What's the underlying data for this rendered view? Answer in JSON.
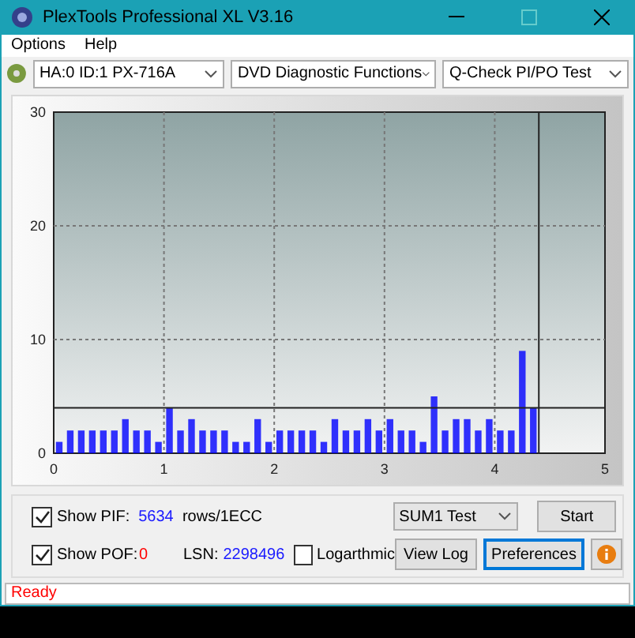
{
  "window": {
    "title": "PlexTools Professional XL V3.16"
  },
  "menu": [
    {
      "label": "Options"
    },
    {
      "label": "Help"
    }
  ],
  "toolbar": {
    "drive": "HA:0 ID:1  PX-716A",
    "function": "DVD Diagnostic Functions",
    "test": "Q-Check PI/PO Test"
  },
  "chart": {
    "chart_data": {
      "type": "bar",
      "xlim": [
        0,
        5
      ],
      "ylim": [
        0,
        30
      ],
      "xticks": [
        0,
        1,
        2,
        3,
        4,
        5
      ],
      "yticks": [
        0,
        10,
        20,
        30
      ],
      "x": [
        0.05,
        0.15,
        0.25,
        0.35,
        0.45,
        0.55,
        0.65,
        0.75,
        0.85,
        0.95,
        1.05,
        1.15,
        1.25,
        1.35,
        1.45,
        1.55,
        1.65,
        1.75,
        1.85,
        1.95,
        2.05,
        2.15,
        2.25,
        2.35,
        2.45,
        2.55,
        2.65,
        2.75,
        2.85,
        2.95,
        3.05,
        3.15,
        3.25,
        3.35,
        3.45,
        3.55,
        3.65,
        3.75,
        3.85,
        3.95,
        4.05,
        4.15,
        4.25,
        4.35
      ],
      "grid": true,
      "series": [
        {
          "color": "#0000ff",
          "values": [
            1,
            2,
            2,
            2,
            2,
            2,
            3,
            2,
            2,
            1,
            4,
            2,
            3,
            2,
            2,
            2,
            1,
            1,
            3,
            1,
            2,
            2,
            2,
            2,
            1,
            3,
            2,
            2,
            3,
            2,
            3,
            2,
            2,
            1,
            5,
            2,
            3,
            3,
            2,
            3,
            2,
            2,
            9,
            4
          ]
        }
      ],
      "ref_lines": [
        {
          "axis": "y",
          "value": 4
        },
        {
          "axis": "x",
          "value": 4.4
        }
      ]
    }
  },
  "controls": {
    "show_pif": {
      "label": "Show PIF:",
      "checked": true,
      "value": "5634"
    },
    "unit": "rows/1ECC",
    "show_pof": {
      "label": "Show POF:",
      "checked": true,
      "value": "0"
    },
    "lsn": {
      "label": "LSN:",
      "value": "2298496"
    },
    "logarithmic": {
      "label": "Logarthmic",
      "checked": false
    },
    "mode": "SUM1 Test",
    "buttons": [
      {
        "label": "Start",
        "selected": false
      },
      {
        "label": "View Log",
        "selected": false
      },
      {
        "label": "Preferences",
        "selected": true
      }
    ]
  },
  "status_bar": {
    "text": "Ready"
  }
}
